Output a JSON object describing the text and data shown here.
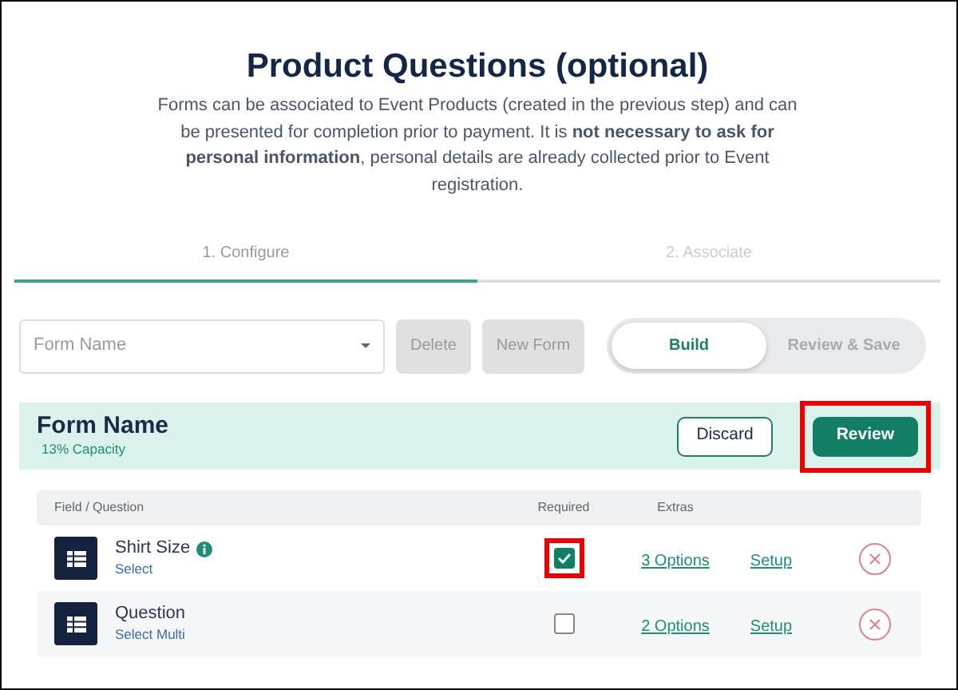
{
  "title": "Product Questions (optional)",
  "description": "Forms can be associated to Event Products (created in the previous step) and can be presented for completion prior to payment. It is **not necessary to ask for personal information**, personal details are already collected prior to Event registration.",
  "steps": [
    {
      "label": "1. Configure",
      "selected": true
    },
    {
      "label": "2. Associate",
      "selected": false
    }
  ],
  "form_select": {
    "placeholder": "Form Name"
  },
  "toolbar_buttons": [
    {
      "label": "Delete",
      "disabled": true
    },
    {
      "label": "New Form",
      "disabled": true
    }
  ],
  "mode_toggle": [
    {
      "label": "Build",
      "selected": true
    },
    {
      "label": "Review & Save",
      "selected": false
    }
  ],
  "form": {
    "name": "Form Name",
    "capacity": "13% Capacity"
  },
  "form_buttons": [
    {
      "label": "Discard",
      "kind": "outline",
      "highlighted": false
    },
    {
      "label": "Review",
      "kind": "solid",
      "highlighted": true
    }
  ],
  "table": {
    "columns": [
      "Field / Question",
      "Required",
      "Extras"
    ],
    "rows": [
      {
        "name": "Shirt Size",
        "info": true,
        "type": "Select",
        "required": true,
        "required_highlighted": true,
        "extras": "3 Options",
        "setup": "Setup"
      },
      {
        "name": "Question",
        "info": false,
        "type": "Select Multi",
        "required": false,
        "required_highlighted": false,
        "extras": "2 Options",
        "setup": "Setup"
      }
    ]
  }
}
